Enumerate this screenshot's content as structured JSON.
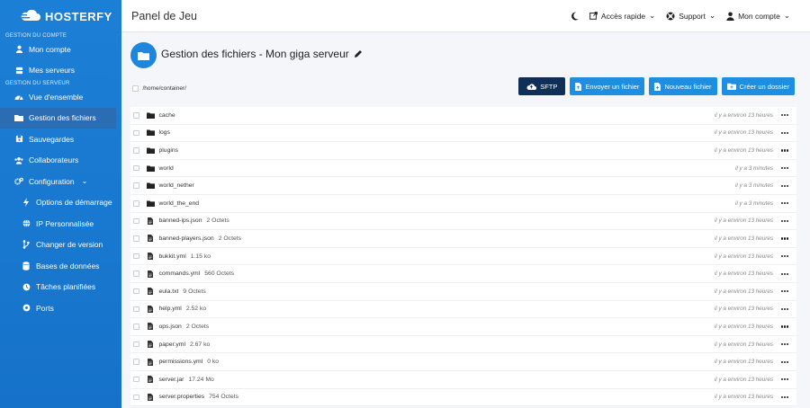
{
  "brand": {
    "name": "HOSTERFY"
  },
  "sidebar": {
    "section_account": "Gestion du compte",
    "section_server": "Gestion du serveur",
    "items": [
      {
        "label": "Mon compte",
        "icon": "user-icon"
      },
      {
        "label": "Mes serveurs",
        "icon": "server-icon"
      },
      {
        "label": "Vue d'ensemble",
        "icon": "dashboard-icon"
      },
      {
        "label": "Gestion des fichiers",
        "icon": "folder-icon"
      },
      {
        "label": "Sauvegardes",
        "icon": "backup-icon"
      },
      {
        "label": "Collaborateurs",
        "icon": "users-icon"
      },
      {
        "label": "Configuration",
        "icon": "gears-icon"
      },
      {
        "label": "Options de démarrage",
        "icon": "bolt-icon"
      },
      {
        "label": "IP Personnalisée",
        "icon": "globe-icon"
      },
      {
        "label": "Changer de version",
        "icon": "code-branch-icon"
      },
      {
        "label": "Bases de données",
        "icon": "database-icon"
      },
      {
        "label": "Tâches planifiées",
        "icon": "clock-icon"
      },
      {
        "label": "Ports",
        "icon": "plug-icon"
      }
    ]
  },
  "header": {
    "title": "Panel de Jeu",
    "quick_access": "Accès rapide",
    "support": "Support",
    "account": "Mon compte"
  },
  "files": {
    "title": "Gestion des fichiers - Mon giga serveur",
    "path": "/home/container/",
    "buttons": {
      "sftp": "SFTP",
      "upload": "Envoyer un fichier",
      "new_file": "Nouveau fichier",
      "new_folder": "Créer un dossier"
    },
    "rows": [
      {
        "type": "folder",
        "name": "cache",
        "size": "",
        "date": "il y a environ 13 heures"
      },
      {
        "type": "folder",
        "name": "logs",
        "size": "",
        "date": "il y a environ 13 heures"
      },
      {
        "type": "folder",
        "name": "plugins",
        "size": "",
        "date": "il y a environ 13 heures"
      },
      {
        "type": "folder",
        "name": "world",
        "size": "",
        "date": "il y a 3 minutes"
      },
      {
        "type": "folder",
        "name": "world_nether",
        "size": "",
        "date": "il y a 3 minutes"
      },
      {
        "type": "folder",
        "name": "world_the_end",
        "size": "",
        "date": "il y a 3 minutes"
      },
      {
        "type": "file",
        "name": "banned-ips.json",
        "size": "2 Octets",
        "date": "il y a environ 13 heures"
      },
      {
        "type": "file",
        "name": "banned-players.json",
        "size": "2 Octets",
        "date": "il y a environ 13 heures"
      },
      {
        "type": "file",
        "name": "bukkit.yml",
        "size": "1.15 ko",
        "date": "il y a environ 13 heures"
      },
      {
        "type": "file",
        "name": "commands.yml",
        "size": "560 Octets",
        "date": "il y a environ 13 heures"
      },
      {
        "type": "file",
        "name": "eula.txt",
        "size": "9 Octets",
        "date": "il y a environ 13 heures"
      },
      {
        "type": "file",
        "name": "help.yml",
        "size": "2.52 ko",
        "date": "il y a environ 13 heures"
      },
      {
        "type": "file",
        "name": "ops.json",
        "size": "2 Octets",
        "date": "il y a environ 13 heures"
      },
      {
        "type": "file",
        "name": "paper.yml",
        "size": "2.67 ko",
        "date": "il y a environ 13 heures"
      },
      {
        "type": "file",
        "name": "permissions.yml",
        "size": "0 ko",
        "date": "il y a environ 13 heures"
      },
      {
        "type": "file",
        "name": "server.jar",
        "size": "17.24 Mo",
        "date": "il y a environ 13 heures"
      },
      {
        "type": "file",
        "name": "server.properties",
        "size": "754 Octets",
        "date": "il y a environ 13 heures"
      }
    ]
  },
  "colors": {
    "sidebar": "#1c7fd6",
    "accent": "#1e8fe0",
    "dark_button": "#0f2f56"
  }
}
